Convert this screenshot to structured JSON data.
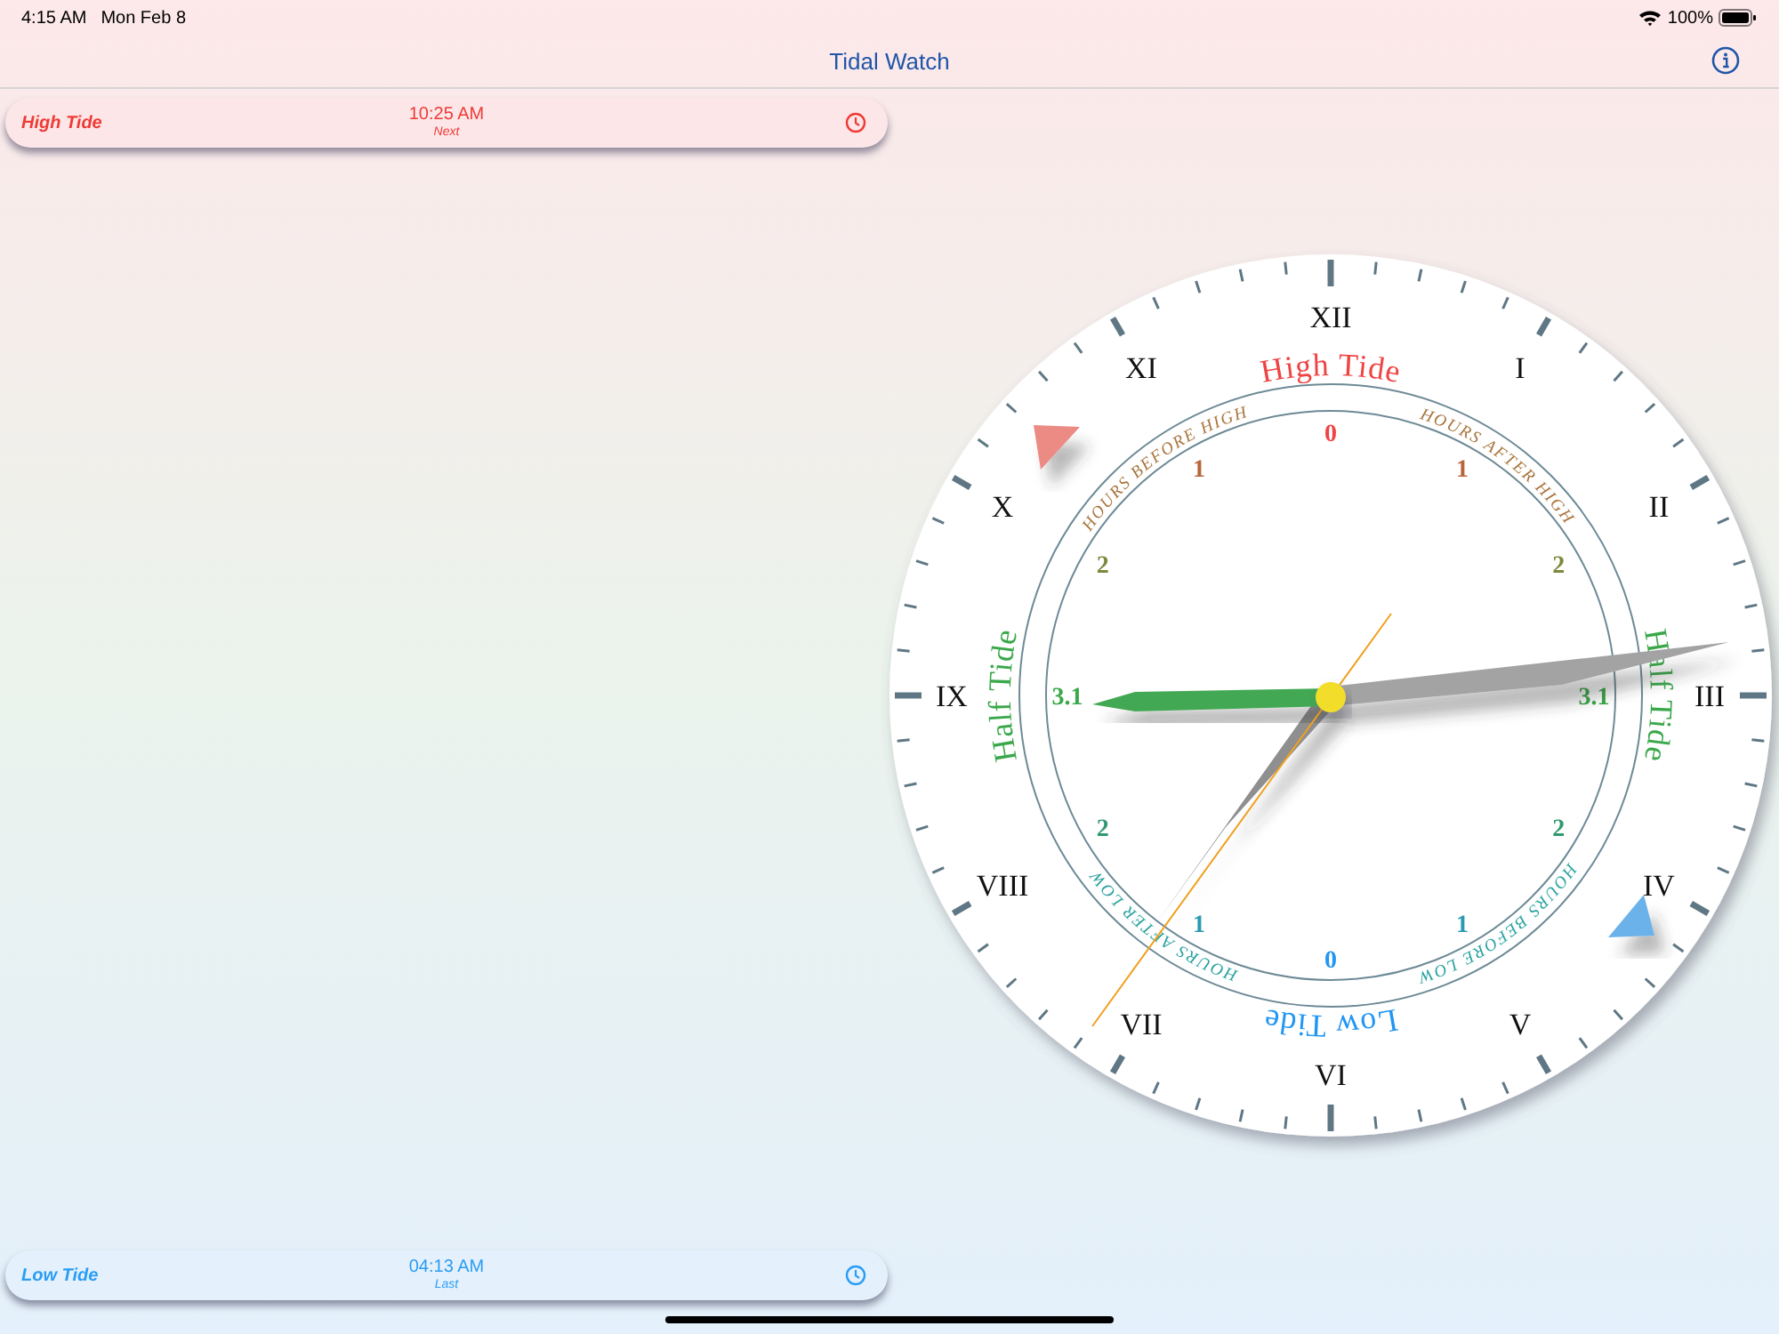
{
  "status_bar": {
    "time": "4:15 AM",
    "date": "Mon Feb 8",
    "battery": "100%"
  },
  "nav_bar": {
    "title": "Tidal Watch"
  },
  "tide_cards": [
    {
      "kind": "high",
      "label": "High Tide",
      "time": "10:25 AM",
      "note": "Next"
    },
    {
      "kind": "low",
      "label": "Low Tide",
      "time": "04:13 AM",
      "note": "Last"
    }
  ],
  "clock": {
    "numerals": [
      "XII",
      "I",
      "II",
      "III",
      "IV",
      "V",
      "VI",
      "VII",
      "VIII",
      "IX",
      "X",
      "XI"
    ],
    "ring_labels": [
      {
        "kind": "high",
        "text": "High Tide",
        "color": "#ef4444"
      },
      {
        "kind": "before_high",
        "text": "HOURS BEFORE HIGH",
        "color": "#a8743c"
      },
      {
        "kind": "after_high",
        "text": "HOURS AFTER HIGH",
        "color": "#a8743c"
      },
      {
        "kind": "half_left",
        "text": "Half Tide",
        "color": "#3aa84a"
      },
      {
        "kind": "half_right",
        "text": "Half Tide",
        "color": "#3aa84a"
      },
      {
        "kind": "after_low",
        "text": "HOURS AFTER LOW",
        "color": "#2aa3a0"
      },
      {
        "kind": "before_low",
        "text": "HOURS BEFORE LOW",
        "color": "#2aa3a0"
      },
      {
        "kind": "low",
        "text": "Low Tide",
        "color": "#2196f3"
      }
    ],
    "hour_scale": [
      {
        "text": "0",
        "color": "#ef4444"
      },
      {
        "text": "1",
        "color": "#b8653a"
      },
      {
        "text": "2",
        "color": "#7a8a3a"
      },
      {
        "text": "3.1",
        "color": "#3aa84a"
      },
      {
        "text": "2",
        "color": "#2e9a6e"
      },
      {
        "text": "1",
        "color": "#2a9ab0"
      },
      {
        "text": "0",
        "color": "#2196f3"
      },
      {
        "text": "1",
        "color": "#2a9ab0"
      },
      {
        "text": "2",
        "color": "#2e9a6e"
      },
      {
        "text": "3.1",
        "color": "#3aa84a"
      },
      {
        "text": "2",
        "color": "#7a8a3a"
      },
      {
        "text": "1",
        "color": "#b8653a"
      }
    ]
  }
}
